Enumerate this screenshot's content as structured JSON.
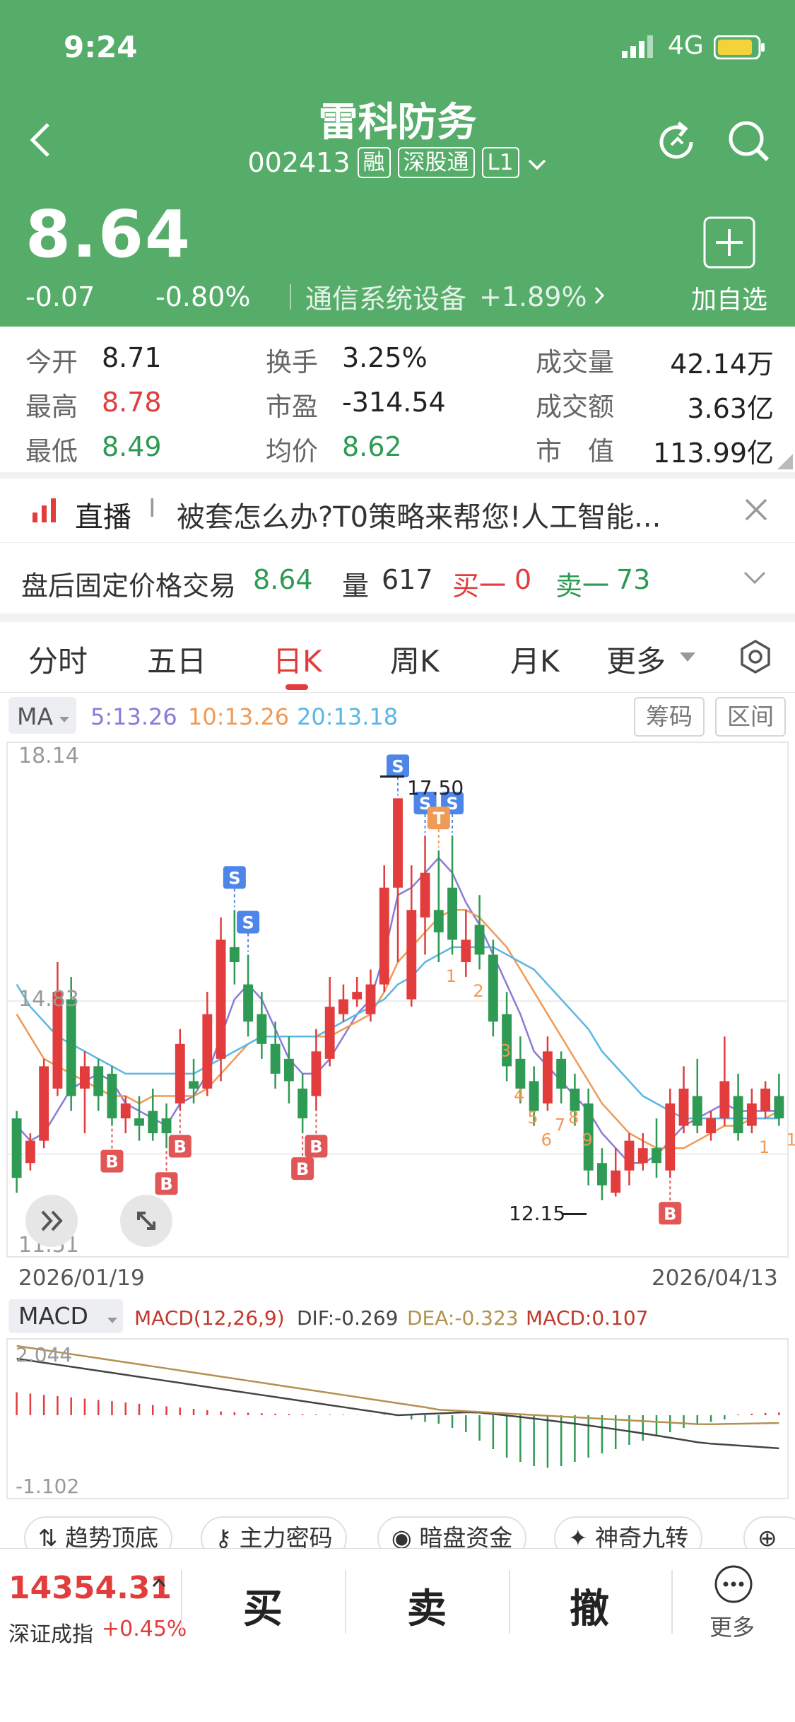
{
  "status_bar": {
    "time": "9:24",
    "network": "4G"
  },
  "header": {
    "title": "雷科防务",
    "code": "002413",
    "tags": [
      "融",
      "深股通",
      "L1"
    ],
    "price": "8.64",
    "change": "-0.07",
    "change_pct": "-0.80%",
    "sector": "通信系统设备",
    "sector_change": "+1.89%",
    "add_watch_label": "加自选"
  },
  "quote": {
    "open_label": "今开",
    "open": "8.71",
    "high_label": "最高",
    "high": "8.78",
    "low_label": "最低",
    "low": "8.49",
    "turnover_label": "换手",
    "turnover": "3.25%",
    "pe_label": "市盈",
    "pe": "-314.54",
    "avg_label": "均价",
    "avg": "8.62",
    "volume_label": "成交量",
    "volume": "42.14万",
    "amount_label": "成交额",
    "amount": "3.63亿",
    "mktcap_label": "市　值",
    "mktcap": "113.99亿"
  },
  "live": {
    "prefix": "直播",
    "sep": "I",
    "text": "被套怎么办?T0策略来帮您!人工智能..."
  },
  "after_hours": {
    "label": "盘后固定价格交易",
    "price": "8.64",
    "vol_label": "量",
    "vol": "617",
    "buy_label": "买一",
    "buy": "0",
    "sell_label": "卖一",
    "sell": "73"
  },
  "tabs": [
    "分时",
    "五日",
    "日K",
    "周K",
    "月K",
    "更多"
  ],
  "active_tab": "日K",
  "ma": {
    "selector": "MA",
    "ma5": "5:13.26",
    "ma10": "10:13.26",
    "ma20": "20:13.18",
    "btn_chips": "筹码",
    "btn_range": "区间"
  },
  "chart_data": {
    "type": "candlestick",
    "y_max_label": "18.14",
    "y_mid_label": "14.83",
    "y_min_label": "11.51",
    "high_marker": "17.50",
    "low_marker": "12.15",
    "date_start": "2026/01/19",
    "date_end": "2026/04/13",
    "ylim": [
      11.51,
      18.14
    ],
    "candles": [
      {
        "o": 13.2,
        "c": 12.4,
        "h": 13.3,
        "l": 12.2
      },
      {
        "o": 12.6,
        "c": 12.9,
        "h": 13.0,
        "l": 12.5
      },
      {
        "o": 12.9,
        "c": 13.9,
        "h": 14.0,
        "l": 12.8
      },
      {
        "o": 13.6,
        "c": 14.9,
        "h": 15.3,
        "l": 13.5
      },
      {
        "o": 14.8,
        "c": 13.5,
        "h": 15.1,
        "l": 13.3
      },
      {
        "o": 13.6,
        "c": 13.9,
        "h": 14.1,
        "l": 13.0
      },
      {
        "o": 13.9,
        "c": 13.5,
        "h": 14.0,
        "l": 13.3
      },
      {
        "o": 13.8,
        "c": 13.2,
        "h": 13.9,
        "l": 13.1
      },
      {
        "o": 13.2,
        "c": 13.4,
        "h": 13.5,
        "l": 13.0
      },
      {
        "o": 13.2,
        "c": 13.1,
        "h": 13.5,
        "l": 12.9
      },
      {
        "o": 13.3,
        "c": 13.0,
        "h": 13.6,
        "l": 12.9
      },
      {
        "o": 13.2,
        "c": 13.0,
        "h": 13.4,
        "l": 12.8
      },
      {
        "o": 13.4,
        "c": 14.2,
        "h": 14.4,
        "l": 13.3
      },
      {
        "o": 13.7,
        "c": 13.6,
        "h": 14.0,
        "l": 13.4
      },
      {
        "o": 13.6,
        "c": 14.6,
        "h": 14.9,
        "l": 13.5
      },
      {
        "o": 14.0,
        "c": 15.6,
        "h": 15.9,
        "l": 13.7
      },
      {
        "o": 15.5,
        "c": 15.3,
        "h": 16.0,
        "l": 15.0
      },
      {
        "o": 15.0,
        "c": 14.5,
        "h": 15.4,
        "l": 14.3
      },
      {
        "o": 14.6,
        "c": 14.2,
        "h": 14.9,
        "l": 14.0
      },
      {
        "o": 14.2,
        "c": 13.8,
        "h": 14.5,
        "l": 13.6
      },
      {
        "o": 14.0,
        "c": 13.7,
        "h": 14.3,
        "l": 13.4
      },
      {
        "o": 13.6,
        "c": 13.2,
        "h": 13.8,
        "l": 13.0
      },
      {
        "o": 13.5,
        "c": 14.1,
        "h": 14.4,
        "l": 13.3
      },
      {
        "o": 14.0,
        "c": 14.7,
        "h": 15.1,
        "l": 13.9
      },
      {
        "o": 14.6,
        "c": 14.8,
        "h": 15.0,
        "l": 14.5
      },
      {
        "o": 14.8,
        "c": 14.9,
        "h": 15.1,
        "l": 14.7
      },
      {
        "o": 14.6,
        "c": 15.0,
        "h": 15.2,
        "l": 14.5
      },
      {
        "o": 15.0,
        "c": 16.3,
        "h": 16.6,
        "l": 14.9
      },
      {
        "o": 16.3,
        "c": 17.5,
        "h": 17.5,
        "l": 15.3
      },
      {
        "o": 14.8,
        "c": 16.0,
        "h": 16.6,
        "l": 14.7
      },
      {
        "o": 15.9,
        "c": 16.5,
        "h": 17.0,
        "l": 15.4
      },
      {
        "o": 16.0,
        "c": 15.7,
        "h": 16.8,
        "l": 15.3
      },
      {
        "o": 16.3,
        "c": 15.6,
        "h": 17.0,
        "l": 15.4
      },
      {
        "o": 15.3,
        "c": 15.6,
        "h": 16.0,
        "l": 15.1
      },
      {
        "o": 15.8,
        "c": 15.4,
        "h": 16.2,
        "l": 15.2
      },
      {
        "o": 15.4,
        "c": 14.5,
        "h": 15.6,
        "l": 14.3
      },
      {
        "o": 14.6,
        "c": 13.9,
        "h": 14.9,
        "l": 13.7
      },
      {
        "o": 14.0,
        "c": 13.6,
        "h": 14.3,
        "l": 13.4
      },
      {
        "o": 13.7,
        "c": 13.3,
        "h": 13.9,
        "l": 13.1
      },
      {
        "o": 13.4,
        "c": 14.1,
        "h": 14.3,
        "l": 13.3
      },
      {
        "o": 14.0,
        "c": 13.6,
        "h": 14.1,
        "l": 13.4
      },
      {
        "o": 13.6,
        "c": 13.3,
        "h": 13.8,
        "l": 13.1
      },
      {
        "o": 13.4,
        "c": 12.5,
        "h": 13.6,
        "l": 12.3
      },
      {
        "o": 12.6,
        "c": 12.3,
        "h": 12.8,
        "l": 12.1
      },
      {
        "o": 12.2,
        "c": 12.5,
        "h": 12.8,
        "l": 12.15
      },
      {
        "o": 12.5,
        "c": 12.9,
        "h": 13.0,
        "l": 12.3
      },
      {
        "o": 12.6,
        "c": 12.8,
        "h": 13.0,
        "l": 12.5
      },
      {
        "o": 12.8,
        "c": 12.6,
        "h": 13.2,
        "l": 12.4
      },
      {
        "o": 12.5,
        "c": 13.4,
        "h": 13.6,
        "l": 12.4
      },
      {
        "o": 13.1,
        "c": 13.6,
        "h": 13.9,
        "l": 13.0
      },
      {
        "o": 13.5,
        "c": 13.1,
        "h": 14.0,
        "l": 13.0
      },
      {
        "o": 13.0,
        "c": 13.2,
        "h": 13.3,
        "l": 12.9
      },
      {
        "o": 13.2,
        "c": 13.7,
        "h": 14.3,
        "l": 13.1
      },
      {
        "o": 13.5,
        "c": 13.0,
        "h": 13.8,
        "l": 12.9
      },
      {
        "o": 13.1,
        "c": 13.4,
        "h": 13.6,
        "l": 13.0
      },
      {
        "o": 13.3,
        "c": 13.6,
        "h": 13.7,
        "l": 13.2
      },
      {
        "o": 13.5,
        "c": 13.2,
        "h": 13.8,
        "l": 13.1
      }
    ],
    "ma5": [
      13.1,
      12.9,
      13.0,
      13.3,
      13.6,
      13.7,
      13.8,
      13.7,
      13.4,
      13.3,
      13.2,
      13.1,
      13.4,
      13.5,
      13.8,
      14.3,
      14.8,
      15.0,
      14.8,
      14.4,
      14.0,
      13.8,
      13.8,
      14.0,
      14.3,
      14.6,
      14.8,
      15.4,
      16.2,
      16.3,
      16.5,
      16.7,
      16.5,
      16.1,
      15.8,
      15.4,
      15.0,
      14.6,
      14.1,
      13.9,
      13.7,
      13.5,
      13.3,
      13.0,
      12.8,
      12.6,
      12.6,
      12.7,
      12.9,
      13.1,
      13.2,
      13.3,
      13.4,
      13.3,
      13.3,
      13.3,
      13.3
    ],
    "ma10": [
      14.6,
      14.3,
      14.0,
      13.9,
      13.8,
      13.7,
      13.6,
      13.5,
      13.5,
      13.4,
      13.5,
      13.5,
      13.5,
      13.5,
      13.6,
      13.8,
      14.0,
      14.2,
      14.3,
      14.3,
      14.3,
      14.3,
      14.3,
      14.3,
      14.4,
      14.5,
      14.6,
      14.9,
      15.3,
      15.5,
      15.7,
      15.9,
      16.0,
      16.0,
      15.9,
      15.7,
      15.5,
      15.2,
      14.9,
      14.6,
      14.3,
      14.0,
      13.7,
      13.4,
      13.2,
      13.0,
      12.9,
      12.8,
      12.8,
      12.8,
      12.9,
      13.0,
      13.1,
      13.1,
      13.2,
      13.2,
      13.3
    ],
    "ma20": [
      15.0,
      14.7,
      14.5,
      14.3,
      14.2,
      14.1,
      14.0,
      13.9,
      13.8,
      13.8,
      13.8,
      13.8,
      13.8,
      13.8,
      13.9,
      14.0,
      14.1,
      14.2,
      14.3,
      14.3,
      14.3,
      14.3,
      14.3,
      14.4,
      14.5,
      14.6,
      14.7,
      14.8,
      15.0,
      15.1,
      15.3,
      15.4,
      15.5,
      15.5,
      15.5,
      15.5,
      15.4,
      15.3,
      15.2,
      15.0,
      14.8,
      14.6,
      14.4,
      14.1,
      13.9,
      13.7,
      13.5,
      13.4,
      13.3,
      13.2,
      13.2,
      13.2,
      13.2,
      13.2,
      13.2,
      13.2,
      13.2
    ],
    "signals_b": [
      "B",
      "B",
      "B",
      "B",
      "B",
      "B"
    ],
    "signals_s": [
      "S",
      "S",
      "S",
      "S",
      "S"
    ],
    "signal_t": "T",
    "nine_turn": [
      "1",
      "2",
      "3",
      "4",
      "5",
      "6",
      "7",
      "8",
      "9",
      "1",
      "1"
    ]
  },
  "macd": {
    "selector": "MACD",
    "params": "MACD(12,26,9)",
    "dif": "DIF:-0.269",
    "dea": "DEA:-0.323",
    "macd": "MACD:0.107",
    "y_max": "2.044",
    "y_min": "-1.102",
    "hist": [
      0.9,
      0.85,
      0.8,
      0.75,
      0.7,
      0.65,
      0.6,
      0.55,
      0.5,
      0.45,
      0.4,
      0.35,
      0.3,
      0.25,
      0.2,
      0.15,
      0.12,
      0.1,
      0.08,
      0.06,
      0.05,
      0.04,
      0.03,
      0.02,
      0.02,
      0.01,
      0.01,
      0.02,
      0.03,
      -0.05,
      -0.08,
      -0.1,
      -0.15,
      -0.2,
      -0.3,
      -0.4,
      -0.5,
      -0.55,
      -0.6,
      -0.62,
      -0.6,
      -0.55,
      -0.5,
      -0.45,
      -0.4,
      -0.35,
      -0.3,
      -0.25,
      -0.2,
      -0.15,
      -0.1,
      -0.08,
      -0.05,
      0.03,
      0.06,
      0.09,
      0.107
    ]
  },
  "chips": [
    "趋势顶底",
    "主力密码",
    "暗盘资金",
    "神奇九转"
  ],
  "bottom": {
    "index_value": "14354.31",
    "index_name": "深证成指",
    "index_change": "+0.45%",
    "buy": "买",
    "sell": "卖",
    "cancel": "撤",
    "more": "更多"
  },
  "colors": {
    "header": "#56ad6a",
    "up": "#e23c3c",
    "down": "#2e9a53",
    "ma5": "#8a7bd8",
    "ma10": "#ef9a55",
    "ma20": "#5ab6e4"
  }
}
